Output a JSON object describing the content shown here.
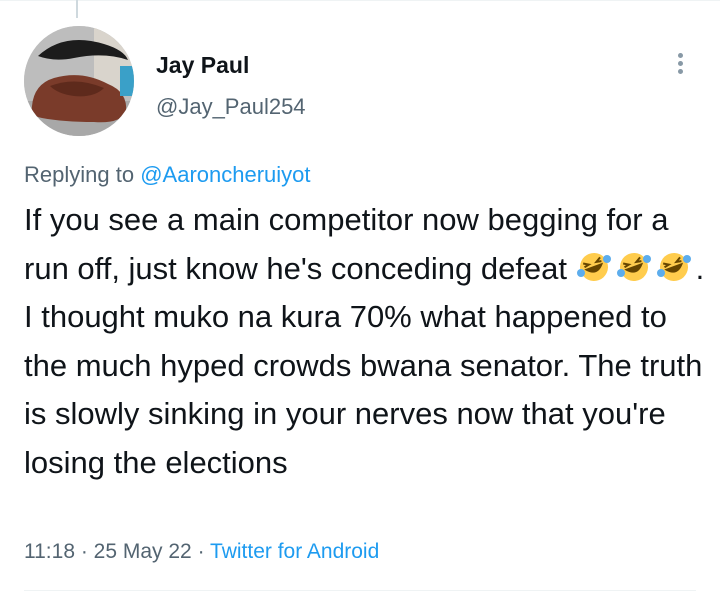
{
  "author": {
    "display_name": "Jay Paul",
    "handle": "@Jay_Paul254",
    "avatar_icon": "shoe-photo-avatar"
  },
  "reply": {
    "prefix": "Replying to",
    "mention": "@Aaroncheruiyot"
  },
  "tweet": {
    "text_part1": "If you see a main competitor now begging for a run off, just know he's conceding defeat ",
    "emojis": [
      "rolling-on-the-floor-laughing-emoji",
      "rolling-on-the-floor-laughing-emoji",
      "rolling-on-the-floor-laughing-emoji"
    ],
    "text_part2": ". I thought muko na kura 70% what happened to the much hyped crowds bwana senator. The truth is slowly sinking in your nerves now that you're losing the elections"
  },
  "meta": {
    "time": "11:18",
    "sep1": " · ",
    "date": "25 May 22",
    "sep2": " · ",
    "source": "Twitter for Android"
  },
  "colors": {
    "text": "#0f1419",
    "secondary": "#536471",
    "link": "#1d9bf0"
  }
}
